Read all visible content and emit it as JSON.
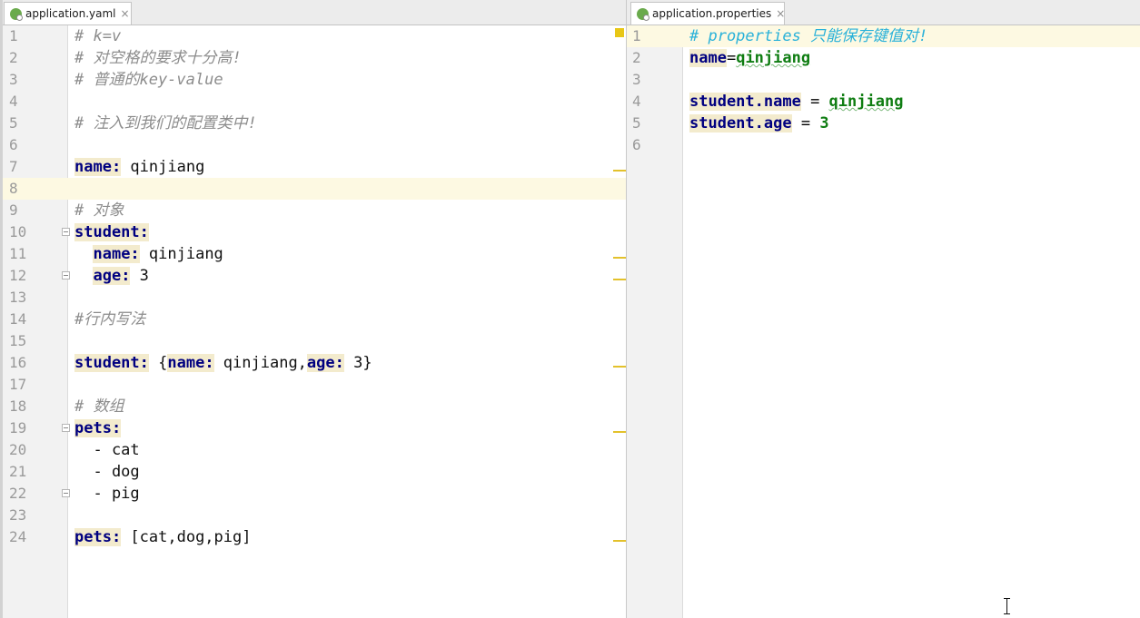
{
  "left_tab": {
    "label": "application.yaml",
    "close": "×"
  },
  "right_tab": {
    "label": "application.properties",
    "close": "×"
  },
  "yaml_lines": [
    [
      {
        "t": "# k=v",
        "c": "comment"
      }
    ],
    [
      {
        "t": "# 对空格的要求十分高!",
        "c": "comment"
      }
    ],
    [
      {
        "t": "# 普通的key-value",
        "c": "comment"
      }
    ],
    [],
    [
      {
        "t": "# 注入到我们的配置类中!",
        "c": "comment"
      }
    ],
    [],
    [
      {
        "t": "name:",
        "c": "key"
      },
      {
        "t": " qinjiang",
        "c": "val"
      }
    ],
    [],
    [
      {
        "t": "# 对象",
        "c": "comment"
      }
    ],
    [
      {
        "t": "student:",
        "c": "key"
      }
    ],
    [
      {
        "t": "  ",
        "c": "val"
      },
      {
        "t": "name:",
        "c": "key"
      },
      {
        "t": " qinjiang",
        "c": "val"
      }
    ],
    [
      {
        "t": "  ",
        "c": "val"
      },
      {
        "t": "age:",
        "c": "key"
      },
      {
        "t": " 3",
        "c": "val"
      }
    ],
    [],
    [
      {
        "t": "#行内写法",
        "c": "comment"
      }
    ],
    [],
    [
      {
        "t": "student:",
        "c": "key"
      },
      {
        "t": " {",
        "c": "val"
      },
      {
        "t": "name:",
        "c": "key"
      },
      {
        "t": " qinjiang,",
        "c": "val"
      },
      {
        "t": "age:",
        "c": "key"
      },
      {
        "t": " 3}",
        "c": "val"
      }
    ],
    [],
    [
      {
        "t": "# 数组",
        "c": "comment"
      }
    ],
    [
      {
        "t": "pets:",
        "c": "key"
      }
    ],
    [
      {
        "t": "  - cat",
        "c": "val"
      }
    ],
    [
      {
        "t": "  - dog",
        "c": "val"
      }
    ],
    [
      {
        "t": "  - pig",
        "c": "val"
      }
    ],
    [],
    [
      {
        "t": "pets:",
        "c": "key"
      },
      {
        "t": " [cat,dog,pig]",
        "c": "val"
      }
    ]
  ],
  "properties_lines": [
    [
      {
        "t": "# properties 只能保存键值对!",
        "c": "comment-prop"
      }
    ],
    [
      {
        "t": "name",
        "c": "key"
      },
      {
        "t": "=",
        "c": "op"
      },
      {
        "t": "qinjiang",
        "c": "pval"
      }
    ],
    [],
    [
      {
        "t": "student.name",
        "c": "key"
      },
      {
        "t": " = ",
        "c": "op"
      },
      {
        "t": "qinjiang",
        "c": "pval"
      }
    ],
    [
      {
        "t": "student.age",
        "c": "key"
      },
      {
        "t": " = ",
        "c": "op"
      },
      {
        "t": "3",
        "c": "pnum"
      }
    ],
    []
  ],
  "yaml_current_line": 8,
  "properties_current_line": 1,
  "colors": {
    "keyword": "#000080",
    "comment": "#8c8c8c",
    "property_comment": "#29b1d9",
    "property_value": "#0f7d12",
    "current_line": "#fdf9e2",
    "change_marker": "#e3c12b"
  },
  "icons": {
    "tab_file": "spring-config-file-icon",
    "text_cursor": "ibeam-cursor-icon"
  }
}
